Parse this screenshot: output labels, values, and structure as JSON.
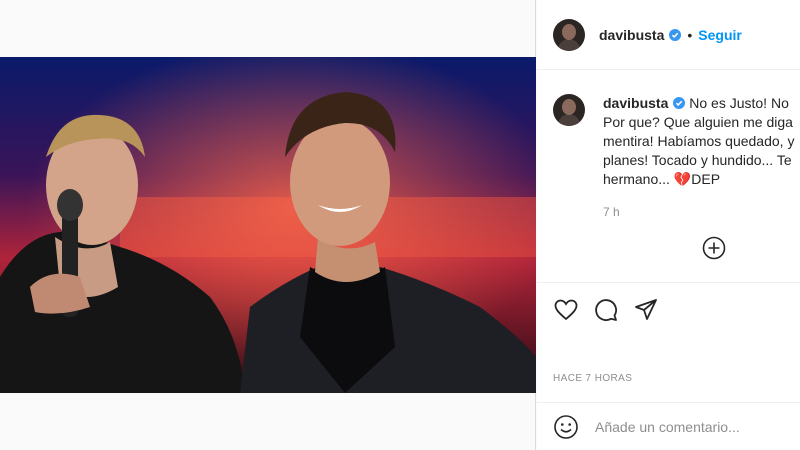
{
  "post": {
    "username": "davibusta",
    "follow_label": "Seguir",
    "separator": "•",
    "verified_icon": "verified-badge-icon",
    "accent_color": "#0095f6"
  },
  "caption": {
    "username": "davibusta",
    "lines": [
      "No es Justo! No",
      "Por que? Que alguien me diga",
      "mentira! Habíamos quedado, y",
      "planes! Tocado y hundido... Te",
      "hermano... 💔DEP"
    ],
    "time": "7 h"
  },
  "actions": {
    "like_icon": "heart-icon",
    "comment_icon": "comment-bubble-icon",
    "share_icon": "send-paper-plane-icon",
    "add_icon": "plus-circle-icon"
  },
  "timeago": "Hace 7 horas",
  "comment_box": {
    "placeholder": "Añade un comentario...",
    "emoji_icon": "emoji-smiley-icon"
  }
}
